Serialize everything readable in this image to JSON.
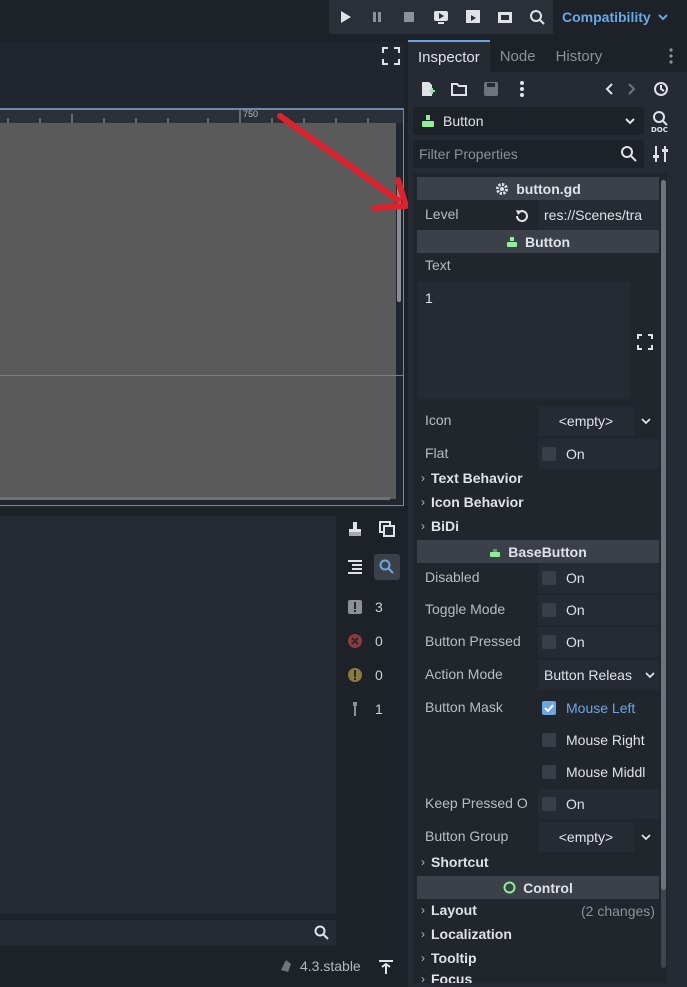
{
  "renderer": {
    "label": "Compatibility"
  },
  "viewport": {
    "ruler_label": "750"
  },
  "output": {
    "counts": {
      "errors": "3",
      "error_x": "0",
      "warnings": "0",
      "messages": "1"
    }
  },
  "status": {
    "version": "4.3.stable"
  },
  "dock": {
    "tabs": [
      "Inspector",
      "Node",
      "History"
    ]
  },
  "inspector": {
    "object_name": "Button",
    "filter_placeholder": "Filter Properties",
    "script_section": "button.gd",
    "level_label": "Level",
    "level_value": "res://Scenes/tra",
    "button_section": "Button",
    "text_label": "Text",
    "text_value": "1",
    "icon_label": "Icon",
    "icon_value": "<empty>",
    "flat_label": "Flat",
    "on": "On",
    "text_behavior": "Text Behavior",
    "icon_behavior": "Icon Behavior",
    "bidi": "BiDi",
    "basebutton_section": "BaseButton",
    "disabled_label": "Disabled",
    "toggle_label": "Toggle Mode",
    "pressed_label": "Button Pressed",
    "action_label": "Action Mode",
    "action_value": "Button Releas",
    "mask_label": "Button Mask",
    "mask_left": "Mouse Left",
    "mask_right": "Mouse Right",
    "mask_middle": "Mouse Middl",
    "keep_label": "Keep Pressed O",
    "group_label": "Button Group",
    "group_value": "<empty>",
    "shortcut": "Shortcut",
    "control_section": "Control",
    "layout": "Layout",
    "layout_changes": "(2 changes)",
    "localization": "Localization",
    "tooltip": "Tooltip",
    "focus": "Focus"
  },
  "colors": {
    "accent": "#6aa6e4",
    "annotation_arrow": "#e0202a",
    "node_green": "#8eef97"
  }
}
